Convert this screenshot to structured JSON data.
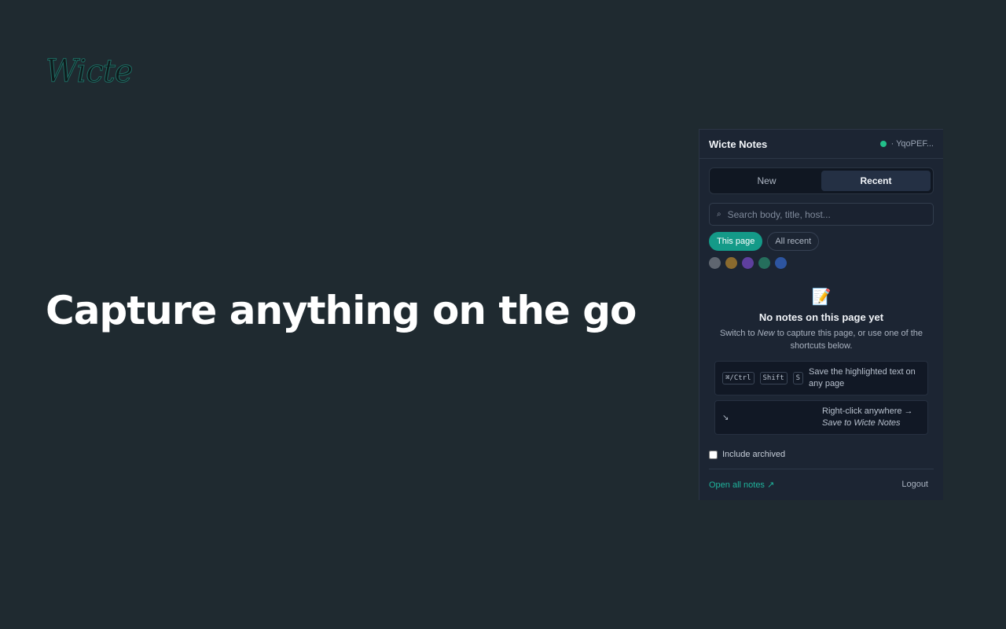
{
  "brand": {
    "logo_text": "Wicte"
  },
  "hero": {
    "headline": "Capture anything on the go"
  },
  "panel": {
    "title": "Wicte Notes",
    "status_text": "· YqoPEF...",
    "tabs": [
      {
        "label": "New",
        "active": false
      },
      {
        "label": "Recent",
        "active": true
      }
    ],
    "search": {
      "icon": "search-icon",
      "placeholder": "Search body, title, host...",
      "value": ""
    },
    "filters": [
      {
        "label": "This page",
        "active": true
      },
      {
        "label": "All recent",
        "active": false
      }
    ],
    "color_filters": [
      "#5f6670",
      "#8a6a2e",
      "#5e3f9e",
      "#256e5c",
      "#2d55a0"
    ],
    "empty_state": {
      "icon": "memo-icon",
      "title": "No notes on this page yet",
      "text_before": "Switch to ",
      "text_em": "New",
      "text_after": " to capture this page, or use one of the shortcuts below."
    },
    "shortcuts": [
      {
        "keys": [
          "⌘/Ctrl",
          "Shift",
          "S"
        ],
        "text": "Save the highlighted text on any page"
      },
      {
        "icon": "arrow-down-right-icon",
        "text_prefix": "Right-click anywhere →",
        "text_em": "Save to Wicte Notes"
      }
    ],
    "include_archived": {
      "label": "Include archived",
      "checked": false
    },
    "footer": {
      "open_all": "Open all notes ↗",
      "logout": "Logout"
    }
  },
  "colors": {
    "background": "#1f2a30",
    "panel": "#1c2533",
    "accent": "#149a88",
    "status": "#22c08a"
  }
}
